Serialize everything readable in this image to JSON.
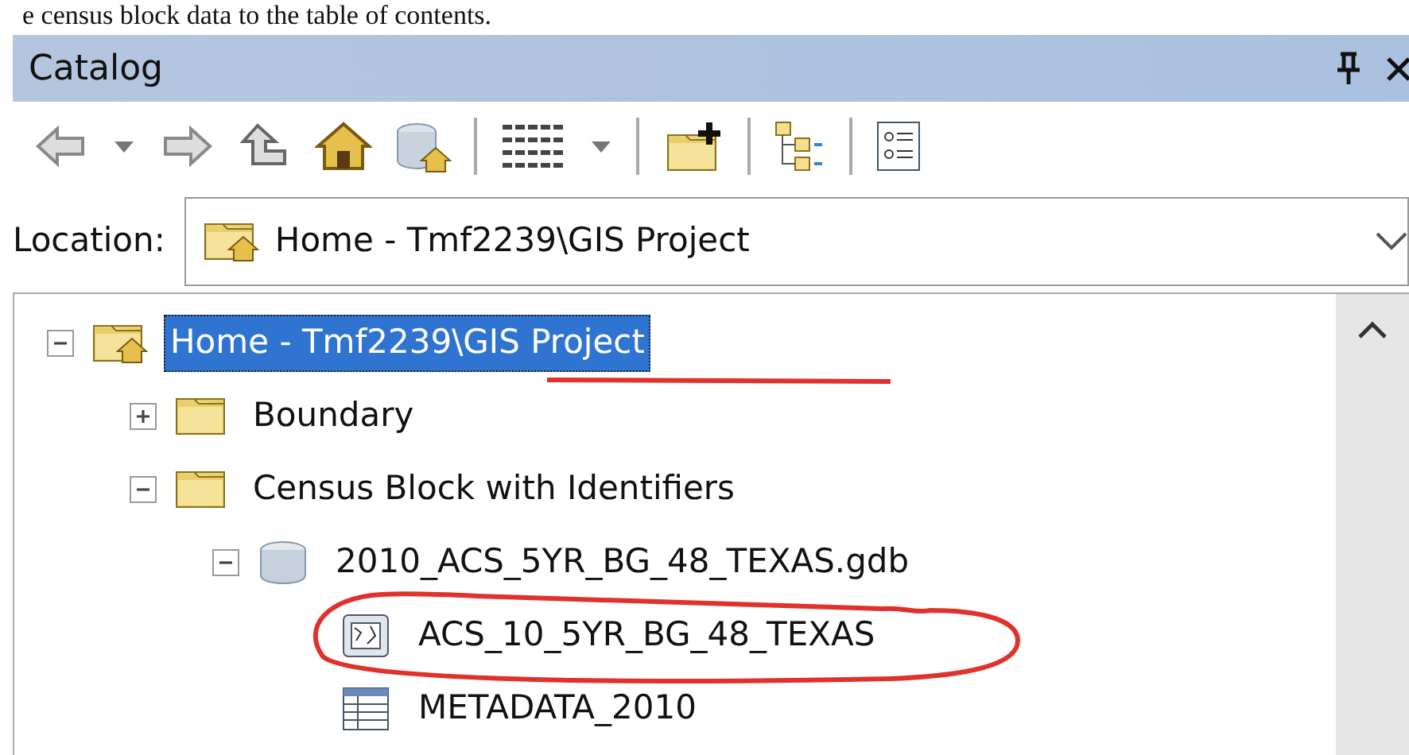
{
  "caption": "e census block data to the table of contents.",
  "window": {
    "title": "Catalog"
  },
  "toolbar": [
    {
      "kind": "back"
    },
    {
      "kind": "dropdown"
    },
    {
      "kind": "forward"
    },
    {
      "kind": "up"
    },
    {
      "kind": "home"
    },
    {
      "kind": "db-home"
    },
    {
      "kind": "separator"
    },
    {
      "kind": "grid"
    },
    {
      "kind": "dropdown"
    },
    {
      "kind": "separator"
    },
    {
      "kind": "add-folder"
    },
    {
      "kind": "separator"
    },
    {
      "kind": "tree"
    },
    {
      "kind": "separator"
    },
    {
      "kind": "list"
    }
  ],
  "location": {
    "label": "Location:",
    "value": "Home - Tmf2239\\GIS Project"
  },
  "tree": [
    {
      "label": "Home - Tmf2239\\GIS Project",
      "kind": "home",
      "expanded": true,
      "selected": true,
      "children": [
        {
          "label": "Boundary",
          "kind": "folder",
          "expanded": false,
          "selected": false
        },
        {
          "label": "Census Block with Identifiers",
          "kind": "folder",
          "expanded": true,
          "selected": false,
          "children": [
            {
              "label": "2010_ACS_5YR_BG_48_TEXAS.gdb",
              "kind": "gdb",
              "expanded": true,
              "selected": false,
              "children": [
                {
                  "label": "ACS_10_5YR_BG_48_TEXAS",
                  "kind": "feature-class",
                  "selected": false
                },
                {
                  "label": "METADATA_2010",
                  "kind": "table",
                  "selected": false
                }
              ]
            }
          ]
        }
      ]
    }
  ]
}
